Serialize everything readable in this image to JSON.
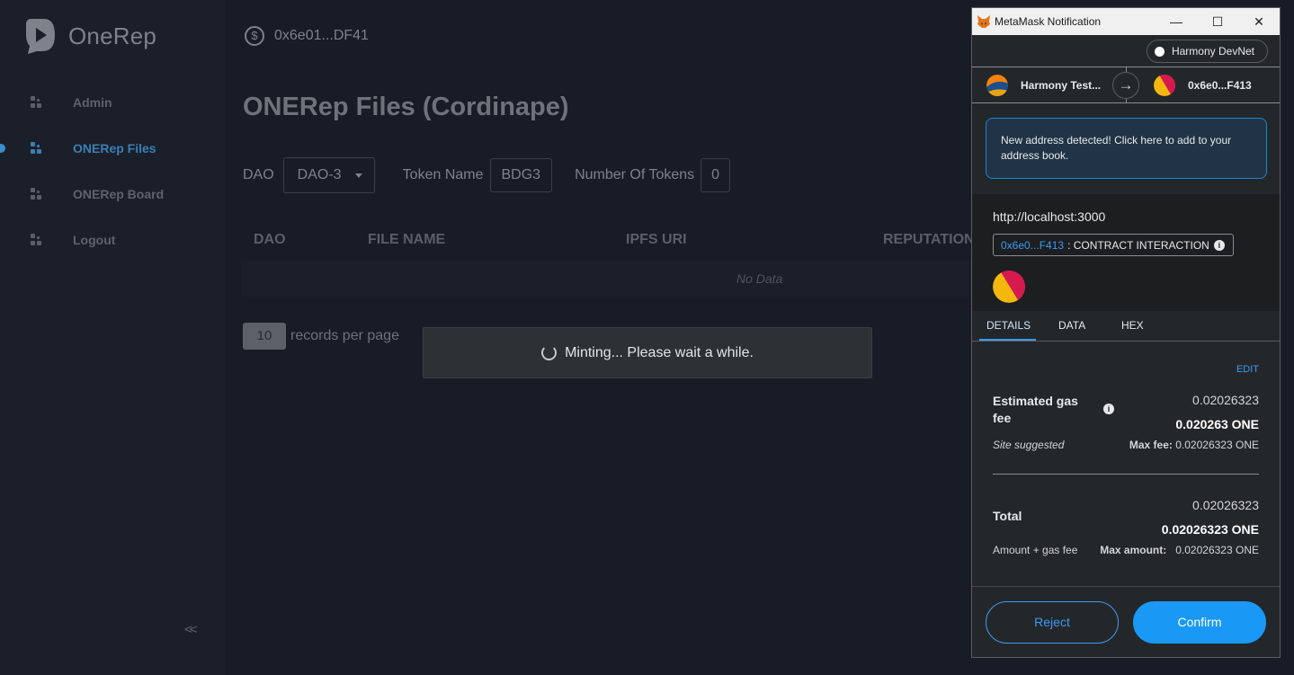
{
  "sidebar": {
    "brand": "OneRep",
    "items": [
      {
        "label": "Admin"
      },
      {
        "label": "ONERep Files"
      },
      {
        "label": "ONERep Board"
      },
      {
        "label": "Logout"
      }
    ],
    "collapse_label": "<<"
  },
  "header": {
    "address": "0x6e01...DF41"
  },
  "main": {
    "title": "ONERep Files (Cordinape)",
    "filters": {
      "dao_label": "DAO",
      "dao_value": "DAO-3",
      "token_name_label": "Token Name",
      "token_name_value": "BDG3",
      "num_tokens_label": "Number Of Tokens",
      "num_tokens_value": "0"
    },
    "table": {
      "columns": [
        "DAO",
        "FILE NAME",
        "IPFS URI",
        "REPUTATION"
      ],
      "empty_text": "No Data"
    },
    "pagination": {
      "per_page_value": "10",
      "per_page_label": "records per page"
    },
    "toast": "Minting... Please wait a while."
  },
  "metamask": {
    "window_title": "MetaMask Notification",
    "network": "Harmony DevNet",
    "from_account": "Harmony Test...",
    "to_account": "0x6e0...F413",
    "notice": "New address detected! Click here to add to your address book.",
    "origin": "http://localhost:3000",
    "contract_address": "0x6e0...F413",
    "contract_label": ": CONTRACT INTERACTION",
    "tabs": [
      "DETAILS",
      "DATA",
      "HEX"
    ],
    "edit_label": "EDIT",
    "gas": {
      "label": "Estimated gas fee",
      "value": "0.02026323",
      "value_one": "0.020263 ONE",
      "site_suggested": "Site suggested",
      "max_fee_label": "Max fee:",
      "max_fee_value": "0.02026323 ONE"
    },
    "total": {
      "label": "Total",
      "value": "0.02026323",
      "value_one": "0.02026323 ONE",
      "sub_label": "Amount + gas fee",
      "max_amount_label": "Max amount:",
      "max_amount_value": "0.02026323 ONE"
    },
    "reject_label": "Reject",
    "confirm_label": "Confirm",
    "colors": {
      "accent": "#1a98f5",
      "link": "#3d9bf2"
    }
  }
}
